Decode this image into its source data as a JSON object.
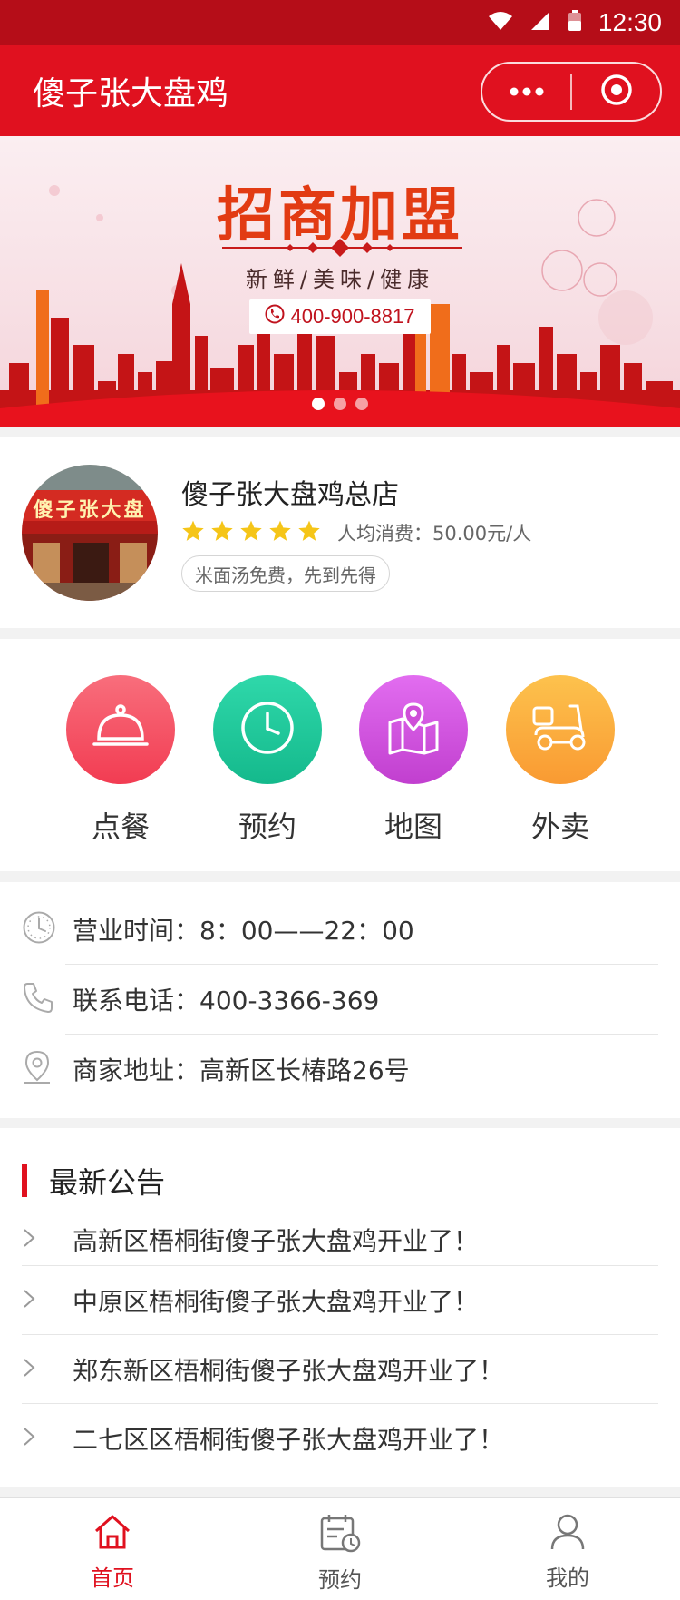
{
  "status_bar": {
    "time": "12:30"
  },
  "header": {
    "title": "傻子张大盘鸡"
  },
  "banner": {
    "headline": "招商加盟",
    "subline": "新鲜/美味/健康",
    "phone": "400-900-8817"
  },
  "store": {
    "name": "傻子张大盘鸡总店",
    "rating_stars": 5,
    "avg_spend": "人均消费：50.00元/人",
    "tag": "米面汤免费，先到先得",
    "avatar_sign": "傻子张大盘"
  },
  "menu": {
    "items": [
      {
        "label": "点餐",
        "icon": "dish-cover-icon",
        "color": "#f4495f"
      },
      {
        "label": "预约",
        "icon": "clock-icon",
        "color": "#1ec49a"
      },
      {
        "label": "地图",
        "icon": "map-pin-icon",
        "color": "#cf4fd8"
      },
      {
        "label": "外卖",
        "icon": "scooter-icon",
        "color": "#fba83a"
      }
    ]
  },
  "info": {
    "hours": "营业时间：8：00——22：00",
    "phone": "联系电话：400-3366-369",
    "address": "商家地址：高新区长椿路26号"
  },
  "notices": {
    "title": "最新公告",
    "items": [
      "高新区梧桐街傻子张大盘鸡开业了！",
      "中原区梧桐街傻子张大盘鸡开业了！",
      "郑东新区梧桐街傻子张大盘鸡开业了！",
      "二七区区梧桐街傻子张大盘鸡开业了！"
    ]
  },
  "tabbar": {
    "items": [
      {
        "label": "首页",
        "active": true
      },
      {
        "label": "预约",
        "active": false
      },
      {
        "label": "我的",
        "active": false
      }
    ]
  },
  "colors": {
    "brand_red": "#e0111f",
    "status_red": "#b50d18",
    "star_yellow": "#f5c518"
  }
}
